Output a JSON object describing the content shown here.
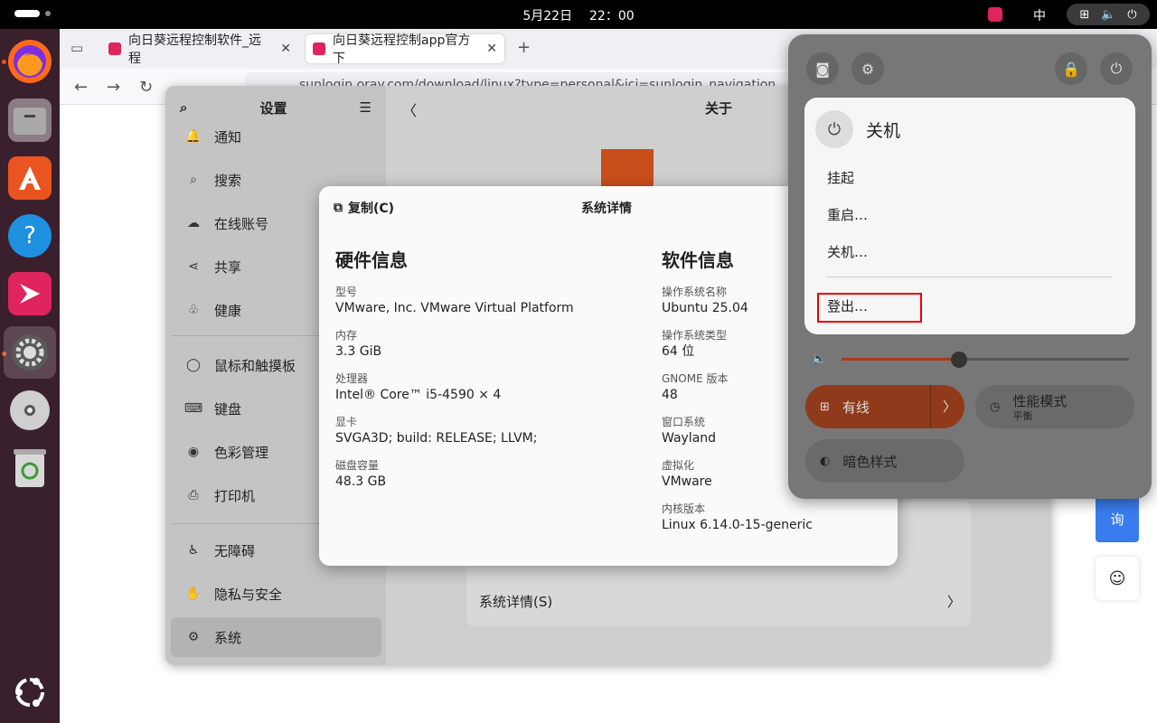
{
  "topbar": {
    "clock_date": "5月22日",
    "clock_time": "22：00",
    "ime": "中"
  },
  "browser": {
    "tabs": [
      {
        "label": "向日葵远程控制软件_远程"
      },
      {
        "label": "向日葵远程控制app官方下"
      }
    ],
    "url": "sunlogin.oray.com/download/linux?type=personal&ici=sunlogin_navigation",
    "side_widget_text": "询"
  },
  "settings": {
    "sidebar_title": "设置",
    "items": [
      {
        "label": "通知"
      },
      {
        "label": "搜索"
      },
      {
        "label": "在线账号"
      },
      {
        "label": "共享"
      },
      {
        "label": "健康"
      },
      {
        "label": "鼠标和触摸板"
      },
      {
        "label": "键盘"
      },
      {
        "label": "色彩管理"
      },
      {
        "label": "打印机"
      },
      {
        "label": "无障碍"
      },
      {
        "label": "隐私与安全"
      },
      {
        "label": "系统"
      }
    ],
    "main_title": "关于",
    "system_details_row": "系统详情(S)"
  },
  "dialog": {
    "copy_label": "复制(C)",
    "title": "系统详情",
    "hardware_title": "硬件信息",
    "hardware": [
      {
        "key": "型号",
        "value": "VMware, Inc. VMware Virtual Platform"
      },
      {
        "key": "内存",
        "value": "3.3 GiB"
      },
      {
        "key": "处理器",
        "value": "Intel® Core™ i5-4590 × 4"
      },
      {
        "key": "显卡",
        "value": "SVGA3D; build: RELEASE; LLVM;"
      },
      {
        "key": "磁盘容量",
        "value": "48.3 GB"
      }
    ],
    "software_title": "软件信息",
    "software": [
      {
        "key": "操作系统名称",
        "value": "Ubuntu 25.04"
      },
      {
        "key": "操作系统类型",
        "value": "64 位"
      },
      {
        "key": "GNOME 版本",
        "value": "48"
      },
      {
        "key": "窗口系统",
        "value": "Wayland"
      },
      {
        "key": "虚拟化",
        "value": "VMware"
      },
      {
        "key": "内核版本",
        "value": "Linux 6.14.0-15-generic"
      }
    ]
  },
  "quick_settings": {
    "power_menu_title": "关机",
    "power_items": [
      "挂起",
      "重启…",
      "关机…",
      "登出…"
    ],
    "volume_fraction": 0.41,
    "wired_label": "有线",
    "power_mode_label": "性能模式",
    "power_mode_value": "平衡",
    "dark_style_label": "暗色样式",
    "accent_color": "#8f3a1a",
    "highlight_color": "#e00000"
  }
}
